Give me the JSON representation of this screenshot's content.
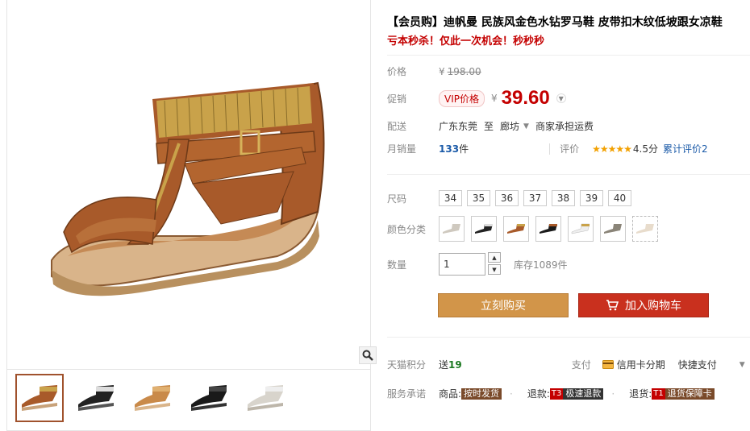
{
  "product": {
    "title": "【会员购】迪帆曼 民族风金色水钻罗马鞋 皮带扣木纹低坡跟女凉鞋",
    "promo": "亏本秒杀！仅此一次机会！秒秒秒"
  },
  "price": {
    "label": "价格",
    "currency": "¥",
    "original": "198.00",
    "promo_label": "促销",
    "vip_label": "VIP价格",
    "current": "39.60"
  },
  "shipping": {
    "label": "配送",
    "from": "广东东莞",
    "to_word": "至",
    "to": "廊坊",
    "note": "商家承担运费"
  },
  "sales": {
    "label": "月销量",
    "count": "133",
    "unit": "件",
    "rating_label": "评价",
    "stars": "★★★★★",
    "score": "4.5分",
    "reviews": "累计评价2"
  },
  "options": {
    "size_label": "尺码",
    "sizes": [
      "34",
      "35",
      "36",
      "37",
      "38",
      "39",
      "40"
    ],
    "color_label": "颜色分类",
    "quantity_label": "数量",
    "quantity": "1",
    "stock": "库存1089件"
  },
  "actions": {
    "buy": "立刻购买",
    "cart": "加入购物车"
  },
  "points": {
    "label": "天猫积分",
    "send": "送",
    "value": "19",
    "pay_label": "支付",
    "credit": "信用卡分期",
    "quick": "快捷支付"
  },
  "service": {
    "label": "服务承诺",
    "goods": "商品:",
    "goods_tag": "按时发货",
    "refund": "退款:",
    "refund_icon": "T3",
    "refund_tag": "极速退款",
    "return": "退货:",
    "return_icon": "T1",
    "return_tag": "退货保障卡"
  },
  "colors": {
    "accent": "#c40000",
    "buy": "#d29549",
    "cart": "#c9301e",
    "sandal_brown": "#a85a2a",
    "gold": "#c9a24a"
  },
  "icons": [
    "zoom-icon",
    "cart-icon",
    "credit-card-icon",
    "chevron-down-icon"
  ]
}
